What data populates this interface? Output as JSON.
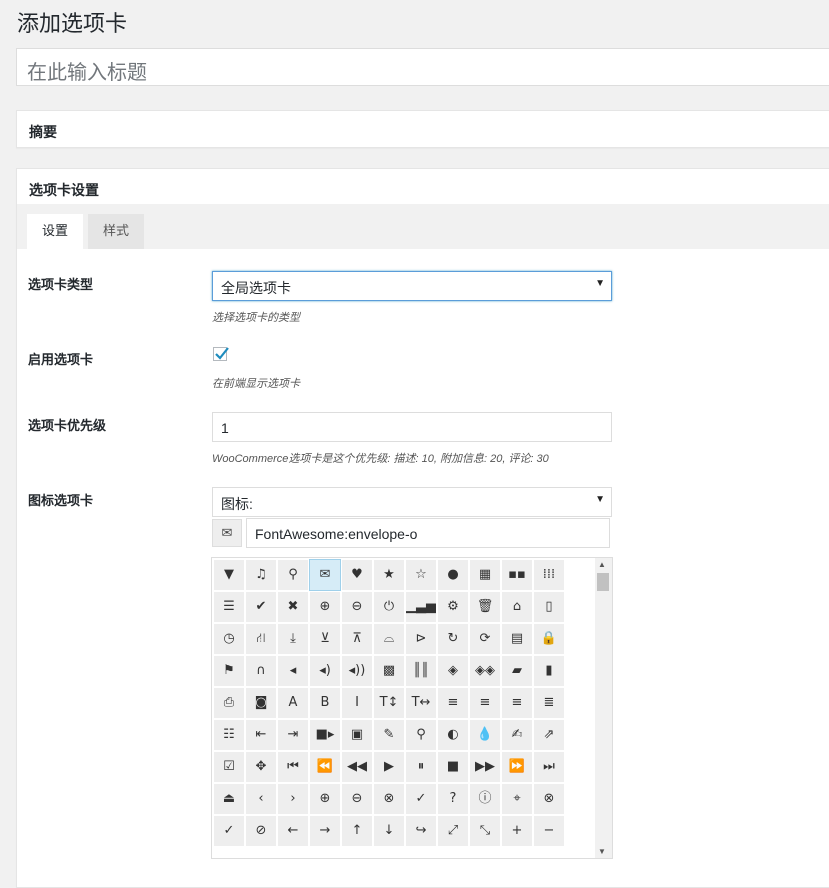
{
  "header": {
    "title": "添加选项卡"
  },
  "title_field": {
    "placeholder": "在此输入标题"
  },
  "excerpt_box": {
    "title": "摘要"
  },
  "tab_settings_box": {
    "title": "选项卡设置",
    "tabs": [
      {
        "label": "设置"
      },
      {
        "label": "样式"
      }
    ],
    "fields": {
      "tab_type": {
        "label": "选项卡类型",
        "value": "全局选项卡",
        "description": "选择选项卡的类型"
      },
      "enable": {
        "label": "启用选项卡",
        "checked": true,
        "description": "在前端显示选项卡"
      },
      "priority": {
        "label": "选项卡优先级",
        "value": "1",
        "description": "WooCommerce选项卡是这个优先级: 描述: 10, 附加信息: 20, 评论: 30"
      },
      "icon": {
        "label": "图标选项卡",
        "select_value": "图标:",
        "selected_icon_name": "FontAwesome:envelope-o",
        "selected_icon": "envelope-o"
      }
    }
  },
  "icon_grid": [
    [
      "filter",
      "music",
      "search",
      "envelope-o",
      "heart",
      "star",
      "star-o",
      "user",
      "film",
      "th-large",
      "th"
    ],
    [
      "th-list",
      "check",
      "times",
      "search-plus",
      "search-minus",
      "power-off",
      "signal",
      "cog",
      "trash-o",
      "home",
      "file-o"
    ],
    [
      "clock-o",
      "road",
      "download",
      "arrow-circle-o-down",
      "arrow-circle-o-up",
      "inbox",
      "play-circle-o",
      "repeat",
      "refresh",
      "list-alt",
      "lock"
    ],
    [
      "flag",
      "headphones",
      "volume-off",
      "volume-down",
      "volume-up",
      "qrcode",
      "barcode",
      "tag",
      "tags",
      "book",
      "bookmark"
    ],
    [
      "print",
      "camera",
      "font",
      "bold",
      "italic",
      "text-height",
      "text-width",
      "align-left",
      "align-center",
      "align-right",
      "align-justify"
    ],
    [
      "list",
      "outdent",
      "indent",
      "video-camera",
      "picture-o",
      "pencil",
      "map-marker",
      "adjust",
      "tint",
      "pencil-square-o",
      "share-square-o"
    ],
    [
      "check-square-o",
      "arrows",
      "step-backward",
      "fast-backward",
      "backward",
      "play",
      "pause",
      "stop",
      "forward",
      "fast-forward",
      "step-forward"
    ],
    [
      "eject",
      "chevron-left",
      "chevron-right",
      "plus-circle",
      "minus-circle",
      "times-circle",
      "check-circle",
      "question-circle",
      "info-circle",
      "crosshairs",
      "times-circle-o"
    ],
    [
      "check-circle-o",
      "ban",
      "arrow-left",
      "arrow-right",
      "arrow-up",
      "arrow-down",
      "share",
      "expand",
      "compress",
      "plus",
      "minus"
    ]
  ],
  "icon_glyphs": {
    "filter": "▼",
    "music": "♫",
    "search": "⚲",
    "envelope-o": "✉",
    "heart": "♥",
    "star": "★",
    "star-o": "☆",
    "user": "●",
    "film": "▦",
    "th-large": "▪▪",
    "th": "⁞⁞⁞",
    "th-list": "☰",
    "check": "✔",
    "times": "✖",
    "search-plus": "⊕",
    "search-minus": "⊖",
    "power-off": "⏻",
    "signal": "▁▃▅",
    "cog": "⚙",
    "trash-o": "🗑",
    "home": "⌂",
    "file-o": "▯",
    "clock-o": "◷",
    "road": "⛙",
    "download": "⤓",
    "arrow-circle-o-down": "⊻",
    "arrow-circle-o-up": "⊼",
    "inbox": "⌓",
    "play-circle-o": "⊳",
    "repeat": "↻",
    "refresh": "⟳",
    "list-alt": "▤",
    "lock": "🔒",
    "flag": "⚑",
    "headphones": "∩",
    "volume-off": "◂",
    "volume-down": "◂)",
    "volume-up": "◂))",
    "qrcode": "▩",
    "barcode": "║║",
    "tag": "◈",
    "tags": "◈◈",
    "book": "▰",
    "bookmark": "▮",
    "print": "⎙",
    "camera": "◙",
    "font": "A",
    "bold": "B",
    "italic": "I",
    "text-height": "T↕",
    "text-width": "T↔",
    "align-left": "≡",
    "align-center": "≡",
    "align-right": "≡",
    "align-justify": "≣",
    "list": "☷",
    "outdent": "⇤",
    "indent": "⇥",
    "video-camera": "■▸",
    "picture-o": "▣",
    "pencil": "✎",
    "map-marker": "⚲",
    "adjust": "◐",
    "tint": "💧",
    "pencil-square-o": "✍",
    "share-square-o": "⇗",
    "check-square-o": "☑",
    "arrows": "✥",
    "step-backward": "⏮",
    "fast-backward": "⏪",
    "backward": "◀◀",
    "play": "▶",
    "pause": "⏸",
    "stop": "■",
    "forward": "▶▶",
    "fast-forward": "⏩",
    "step-forward": "⏭",
    "eject": "⏏",
    "chevron-left": "‹",
    "chevron-right": "›",
    "plus-circle": "⊕",
    "minus-circle": "⊖",
    "times-circle": "⊗",
    "check-circle": "✓",
    "question-circle": "?",
    "info-circle": "ⓘ",
    "crosshairs": "⌖",
    "times-circle-o": "⊗",
    "check-circle-o": "✓",
    "ban": "⊘",
    "arrow-left": "←",
    "arrow-right": "→",
    "arrow-up": "↑",
    "arrow-down": "↓",
    "share": "↪",
    "expand": "⤢",
    "compress": "⤡",
    "plus": "+",
    "minus": "−"
  }
}
